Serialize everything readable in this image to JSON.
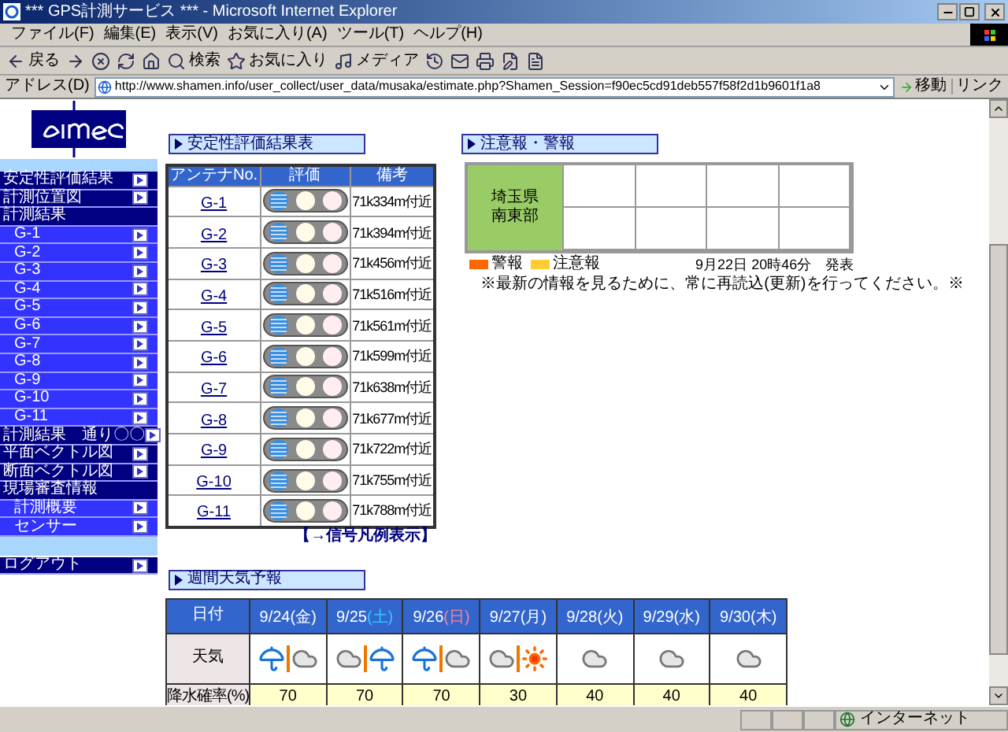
{
  "window": {
    "title": "*** GPS計測サービス *** - Microsoft Internet Explorer"
  },
  "menu": [
    "ファイル(F)",
    "編集(E)",
    "表示(V)",
    "お気に入り(A)",
    "ツール(T)",
    "ヘルプ(H)"
  ],
  "toolbar": [
    {
      "kind": "back",
      "label": "戻る"
    },
    {
      "kind": "forward"
    },
    {
      "kind": "stop"
    },
    {
      "kind": "refresh"
    },
    {
      "kind": "home"
    },
    {
      "kind": "search",
      "label": "検索"
    },
    {
      "kind": "favorites",
      "label": "お気に入り"
    },
    {
      "kind": "media",
      "label": "メディア"
    },
    {
      "kind": "history"
    },
    {
      "kind": "mail"
    },
    {
      "kind": "print"
    },
    {
      "kind": "edit"
    },
    {
      "kind": "doc"
    }
  ],
  "address": {
    "label": "アドレス(D)",
    "url": "http://www.shamen.info/user_collect/user_data/musaka/estimate.php?Shamen_Session=f90ec5cd91deb557f58f2d1b9601f1a8",
    "go": "移動",
    "links": "リンク"
  },
  "sidebar": {
    "items": [
      {
        "label": "安定性評価結果",
        "kind": "link"
      },
      {
        "label": "計測位置図",
        "kind": "link"
      },
      {
        "label": "計測結果",
        "kind": "section",
        "children": [
          {
            "label": "G-1",
            "kind": "link"
          },
          {
            "label": "G-2",
            "kind": "link"
          },
          {
            "label": "G-3",
            "kind": "link"
          },
          {
            "label": "G-4",
            "kind": "link"
          },
          {
            "label": "G-5",
            "kind": "link"
          },
          {
            "label": "G-6",
            "kind": "link"
          },
          {
            "label": "G-7",
            "kind": "link"
          },
          {
            "label": "G-8",
            "kind": "link"
          },
          {
            "label": "G-9",
            "kind": "link"
          },
          {
            "label": "G-10",
            "kind": "link"
          },
          {
            "label": "G-11",
            "kind": "link"
          }
        ]
      },
      {
        "label": "計測結果　通り〇〇",
        "kind": "link"
      },
      {
        "label": "平面ベクトル図",
        "kind": "link"
      },
      {
        "label": "断面ベクトル図",
        "kind": "link"
      },
      {
        "label": "現場審査情報",
        "kind": "section",
        "children": [
          {
            "label": "計測概要",
            "kind": "link"
          },
          {
            "label": "センサー",
            "kind": "link"
          }
        ]
      }
    ],
    "logout": "ログアウト"
  },
  "stability": {
    "title": "安定性評価結果表",
    "columns": [
      "アンテナNo.",
      "評価",
      "備考"
    ],
    "rows": [
      {
        "antenna": "G-1",
        "color": "#3a8ee0",
        "note": "71k334m付近"
      },
      {
        "antenna": "G-2",
        "color": "#3a8ee0",
        "note": "71k394m付近"
      },
      {
        "antenna": "G-3",
        "color": "#3a8ee0",
        "note": "71k456m付近"
      },
      {
        "antenna": "G-4",
        "color": "#3a8ee0",
        "note": "71k516m付近"
      },
      {
        "antenna": "G-5",
        "color": "#3a8ee0",
        "note": "71k561m付近"
      },
      {
        "antenna": "G-6",
        "color": "#3a8ee0",
        "note": "71k599m付近"
      },
      {
        "antenna": "G-7",
        "color": "#3a8ee0",
        "note": "71k638m付近"
      },
      {
        "antenna": "G-8",
        "color": "#3a8ee0",
        "note": "71k677m付近"
      },
      {
        "antenna": "G-9",
        "color": "#3a8ee0",
        "note": "71k722m付近"
      },
      {
        "antenna": "G-10",
        "color": "#3a8ee0",
        "note": "71k755m付近"
      },
      {
        "antenna": "G-11",
        "color": "#3a8ee0",
        "note": "71k788m付近"
      }
    ],
    "legend_link": "【→信号凡例表示】"
  },
  "alerts": {
    "title": "注意報・警報",
    "region": [
      "埼玉県",
      "南東部"
    ],
    "legend": [
      {
        "label": "警報",
        "color": "#ff6600"
      },
      {
        "label": "注意報",
        "color": "#ffcc33"
      }
    ],
    "issued": "9月22日 20時46分　発表",
    "note": "※最新の情報を見るために、常に再読込(更新)を行ってください。※"
  },
  "weather": {
    "title": "週間天気予報",
    "row_labels": [
      "日付",
      "天気",
      "降水確率(%)"
    ],
    "days": [
      {
        "date": "9/24",
        "weekday": "(金)",
        "color": "#ffffff",
        "icons": [
          {
            "kind": "rain"
          },
          {
            "kind": "cloud"
          }
        ],
        "precip": "70"
      },
      {
        "date": "9/25",
        "weekday": "(土)",
        "color": "#33ccff",
        "icons": [
          {
            "kind": "cloud"
          },
          {
            "kind": "rain"
          }
        ],
        "precip": "70"
      },
      {
        "date": "9/26",
        "weekday": "(日)",
        "color": "#ff8099",
        "icons": [
          {
            "kind": "rain"
          },
          {
            "kind": "cloud"
          }
        ],
        "precip": "70"
      },
      {
        "date": "9/27",
        "weekday": "(月)",
        "color": "#ffffff",
        "icons": [
          {
            "kind": "cloud"
          },
          {
            "kind": "sun"
          }
        ],
        "precip": "30"
      },
      {
        "date": "9/28",
        "weekday": "(火)",
        "color": "#ffffff",
        "icons": [
          {
            "kind": "cloud"
          }
        ],
        "precip": "40"
      },
      {
        "date": "9/29",
        "weekday": "(水)",
        "color": "#ffffff",
        "icons": [
          {
            "kind": "cloud"
          }
        ],
        "precip": "40"
      },
      {
        "date": "9/30",
        "weekday": "(木)",
        "color": "#ffffff",
        "icons": [
          {
            "kind": "cloud"
          }
        ],
        "precip": "40"
      }
    ]
  },
  "status_bar": {
    "zone": "インターネット"
  }
}
